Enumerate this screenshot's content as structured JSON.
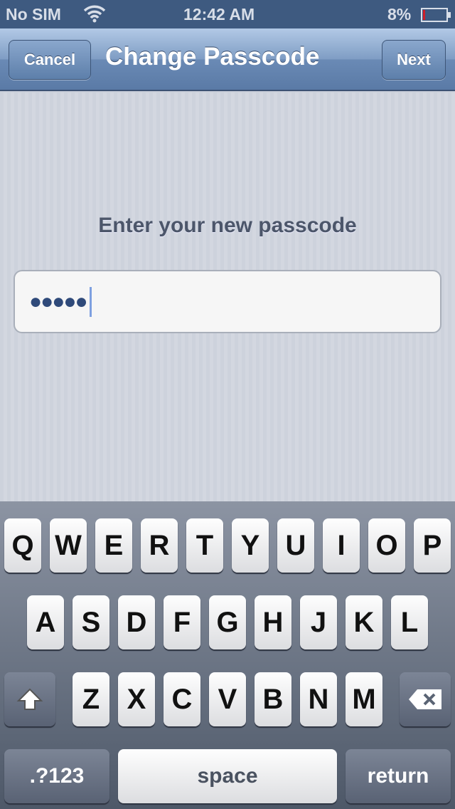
{
  "status": {
    "carrier": "No SIM",
    "time": "12:42 AM",
    "battery": "8%",
    "battery_level": 0.08,
    "battery_color": "#d0202a"
  },
  "nav": {
    "cancel": "Cancel",
    "title": "Change Passcode",
    "next": "Next"
  },
  "main": {
    "prompt": "Enter your new passcode",
    "field_value": "●●●●●"
  },
  "keyboard": {
    "row1": [
      "Q",
      "W",
      "E",
      "R",
      "T",
      "Y",
      "U",
      "I",
      "O",
      "P"
    ],
    "row2": [
      "A",
      "S",
      "D",
      "F",
      "G",
      "H",
      "J",
      "K",
      "L"
    ],
    "row3": [
      "Z",
      "X",
      "C",
      "V",
      "B",
      "N",
      "M"
    ],
    "numbers": ".?123",
    "space": "space",
    "return": "return"
  }
}
